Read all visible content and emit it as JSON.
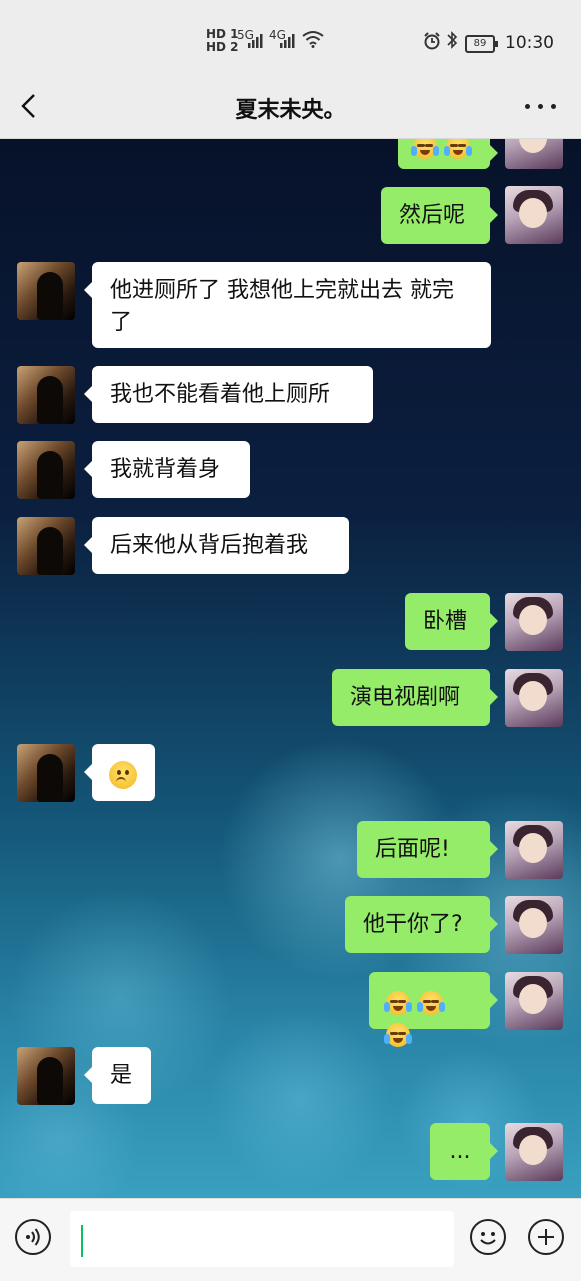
{
  "status_bar": {
    "network_hd_1": "HD 1",
    "network_hd_2": "HD 2",
    "network_5g": "5G",
    "network_4g": "4G",
    "battery_level": "89",
    "time": "10:30"
  },
  "nav": {
    "title": "夏末未央。",
    "back_icon": "chevron-left-icon",
    "more_icon": "more-dots-icon"
  },
  "messages": [
    {
      "side": "right",
      "type": "emoji",
      "emojis": [
        "cry-laugh",
        "cry-laugh"
      ],
      "partial": true
    },
    {
      "side": "right",
      "type": "text",
      "text": "然后呢"
    },
    {
      "side": "left",
      "type": "text",
      "text": "他进厕所了 我想他上完就出去 就完了"
    },
    {
      "side": "left",
      "type": "text",
      "text": "我也不能看着他上厕所"
    },
    {
      "side": "left",
      "type": "text",
      "text": "我就背着身"
    },
    {
      "side": "left",
      "type": "text",
      "text": "后来他从背后抱着我"
    },
    {
      "side": "right",
      "type": "text",
      "text": "卧槽"
    },
    {
      "side": "right",
      "type": "text",
      "text": "演电视剧啊"
    },
    {
      "side": "left",
      "type": "emoji",
      "emojis": [
        "worried"
      ]
    },
    {
      "side": "right",
      "type": "text",
      "text": "后面呢!"
    },
    {
      "side": "right",
      "type": "text",
      "text": "他干你了?"
    },
    {
      "side": "right",
      "type": "emoji",
      "emojis": [
        "cry-laugh",
        "cry-laugh",
        "cry-laugh"
      ]
    },
    {
      "side": "left",
      "type": "text",
      "text": "是"
    },
    {
      "side": "right",
      "type": "text",
      "text": "..."
    }
  ],
  "input_bar": {
    "voice_icon": "voice-icon",
    "input_value": "",
    "emoji_icon": "emoji-icon",
    "plus_icon": "plus-icon"
  }
}
